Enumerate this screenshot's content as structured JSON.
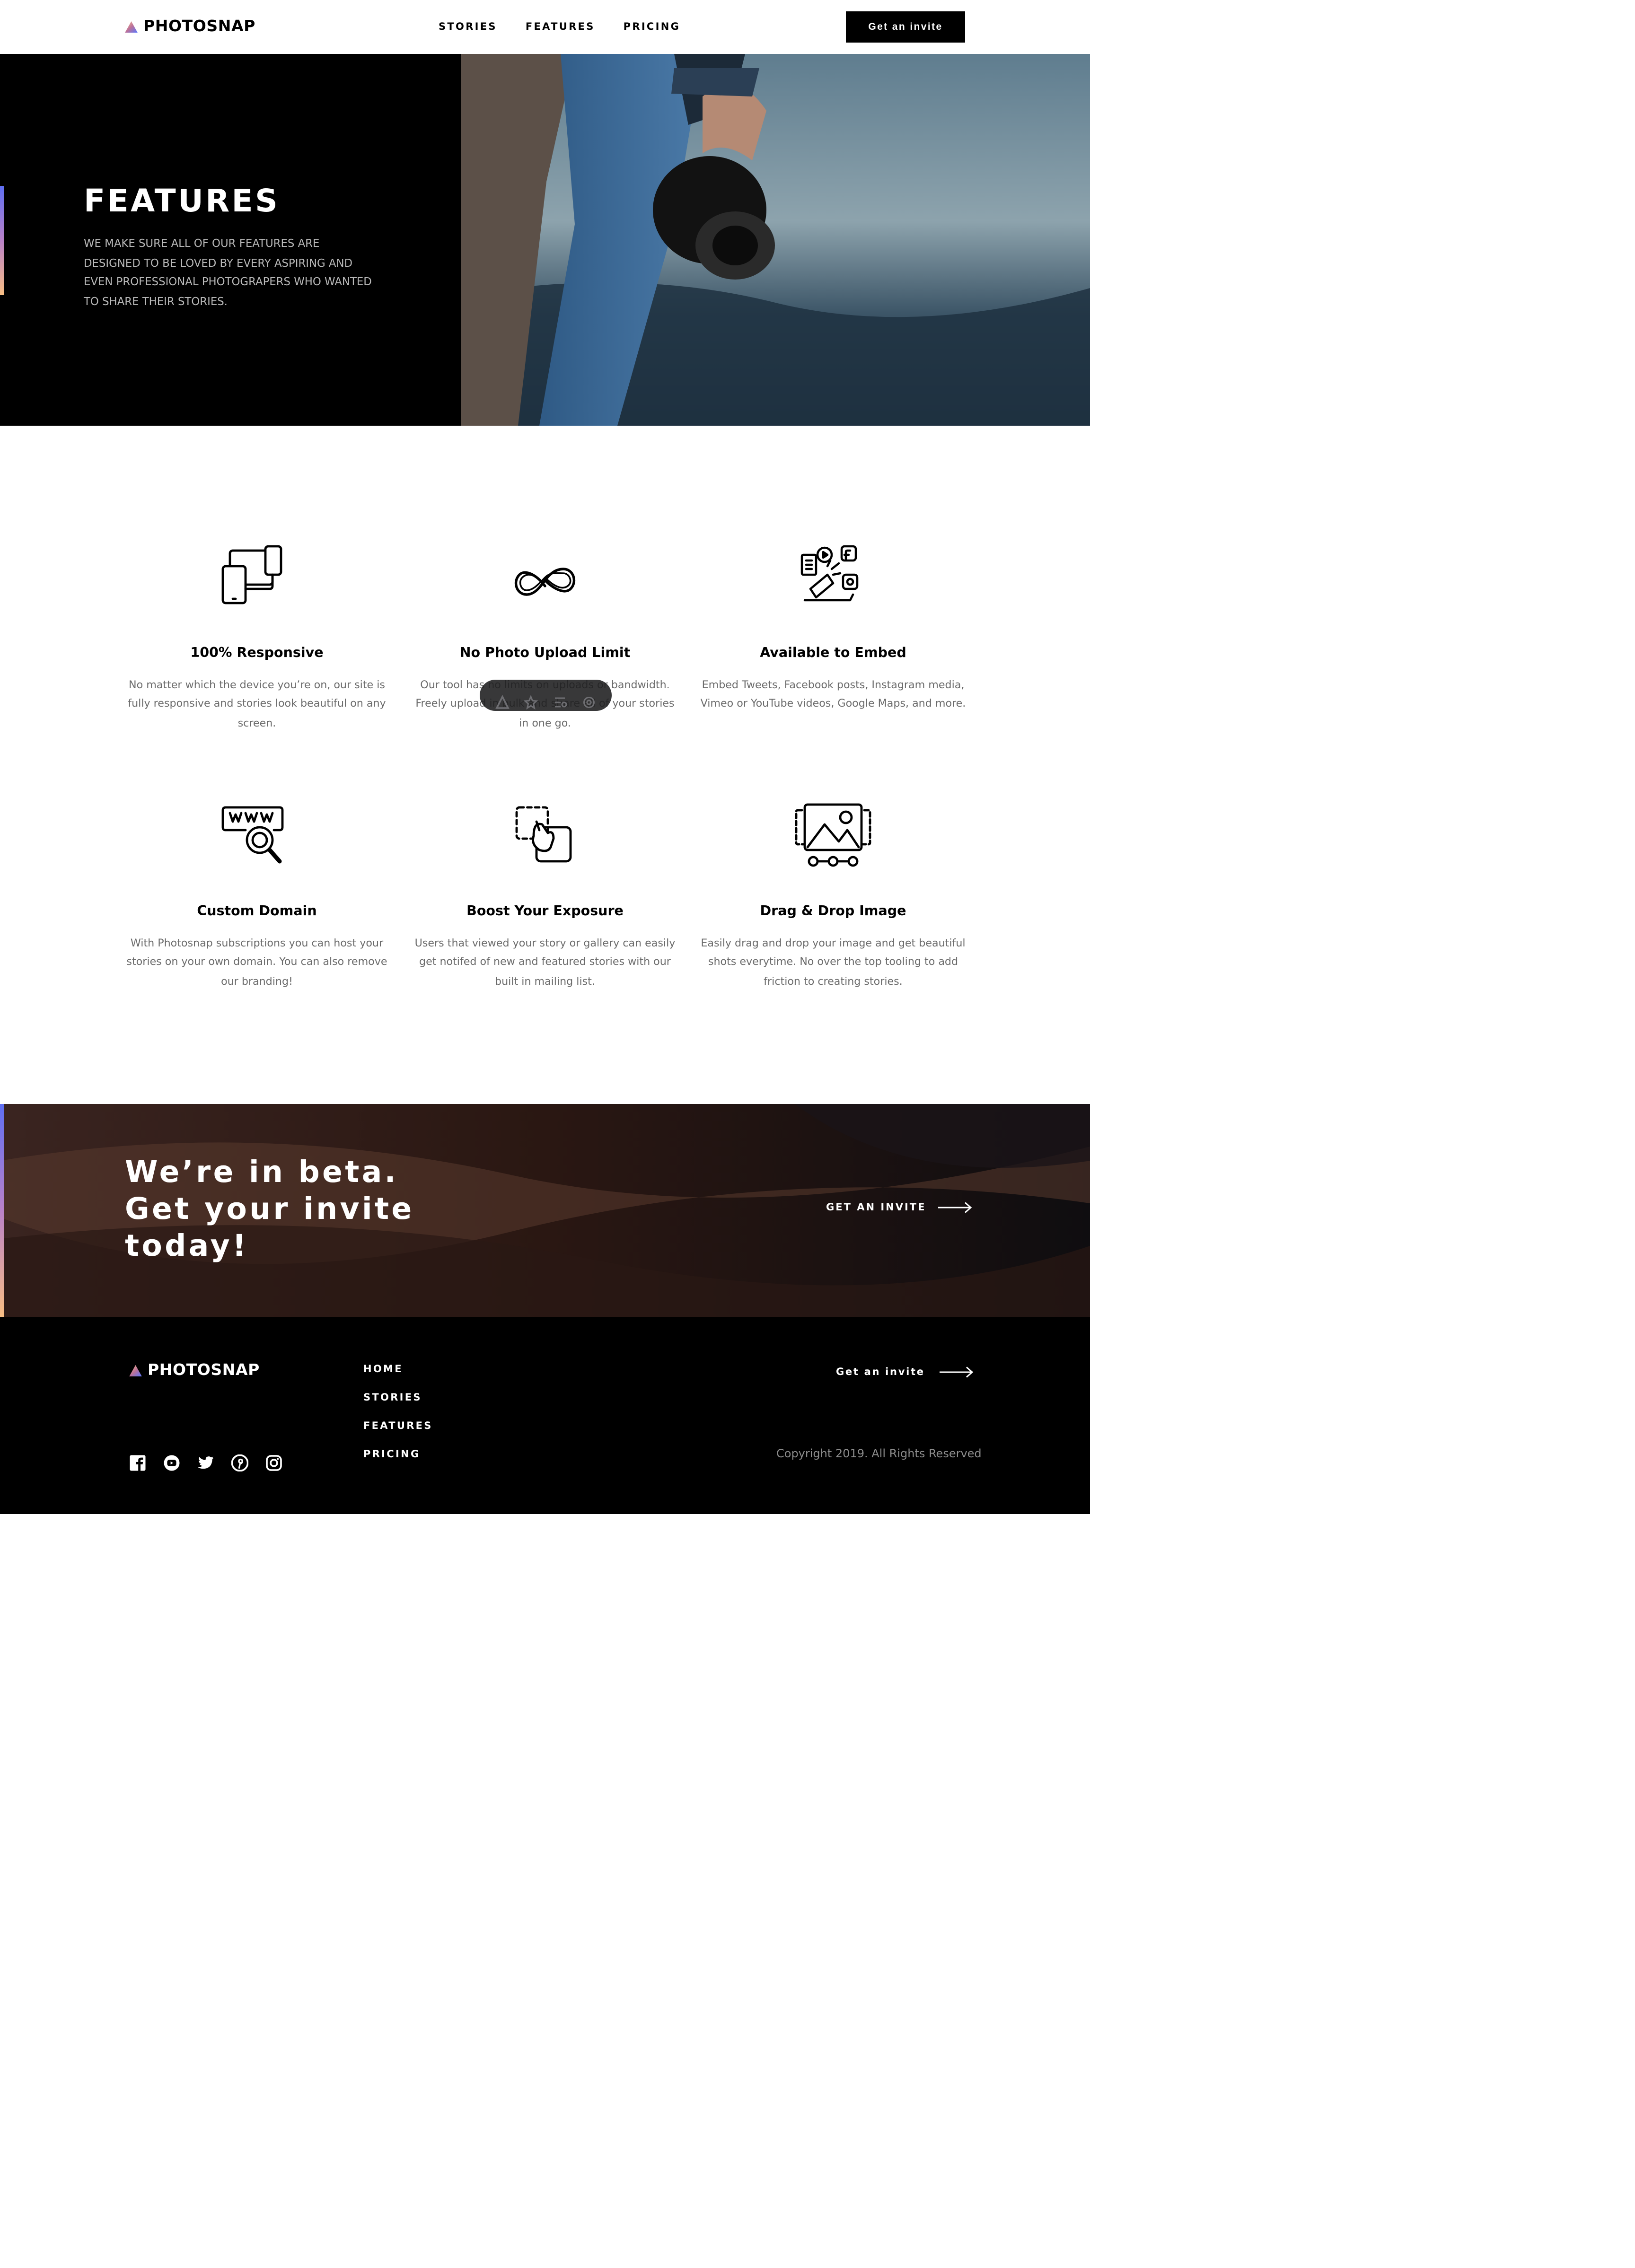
{
  "brand": {
    "name": "PHOTOSNAP",
    "gradient_colors": [
      "#FFC593",
      "#BC7198",
      "#5A77FF"
    ]
  },
  "header": {
    "nav": [
      "STORIES",
      "FEATURES",
      "PRICING"
    ],
    "cta_label": "Get an invite"
  },
  "hero": {
    "title": "FEATURES",
    "description": "WE MAKE SURE ALL OF OUR FEATURES ARE DESIGNED TO BE LOVED BY EVERY ASPIRING AND EVEN PROFESSIONAL PHOTOGRAPERS WHO WANTED TO SHARE THEIR STORIES."
  },
  "features": [
    {
      "title": "100% Responsive",
      "description": "No matter which the device you’re on, our site is fully responsive and stories look beautiful on any screen.",
      "icon": "responsive-devices-icon"
    },
    {
      "title": "No Photo Upload Limit",
      "description": "Our tool has no limits on uploads or bandwidth. Freely upload in bulk and share all of your stories in one go.",
      "icon": "infinity-icon"
    },
    {
      "title": "Available to Embed",
      "description": "Embed Tweets, Facebook posts, Instagram media, Vimeo or YouTube videos, Google Maps, and more.",
      "icon": "embed-media-icon"
    },
    {
      "title": "Custom Domain",
      "description": "With Photosnap subscriptions you can host your stories on your own domain. You can also remove our branding!",
      "icon": "custom-domain-icon"
    },
    {
      "title": "Boost Your Exposure",
      "description": "Users that viewed your story or gallery can easily get notifed of new and featured stories with our built in mailing list.",
      "icon": "boost-exposure-icon"
    },
    {
      "title": "Drag & Drop Image",
      "description": "Easily drag and drop your image and get beautiful shots everytime. No over the top tooling to add friction to creating stories.",
      "icon": "drag-drop-image-icon"
    }
  ],
  "overlay_toolbar": {
    "icons": [
      "a11y-icon",
      "star-icon",
      "list-search-icon",
      "settings-icon"
    ]
  },
  "beta": {
    "heading": "We’re in beta. Get your invite today!",
    "cta_label": "GET AN INVITE"
  },
  "footer": {
    "links": [
      "HOME",
      "STORIES",
      "FEATURES",
      "PRICING"
    ],
    "social_icons": [
      "facebook-icon",
      "youtube-icon",
      "twitter-icon",
      "pinterest-icon",
      "instagram-icon"
    ],
    "cta_label": "Get an invite",
    "copyright": "Copyright 2019. All Rights Reserved"
  }
}
